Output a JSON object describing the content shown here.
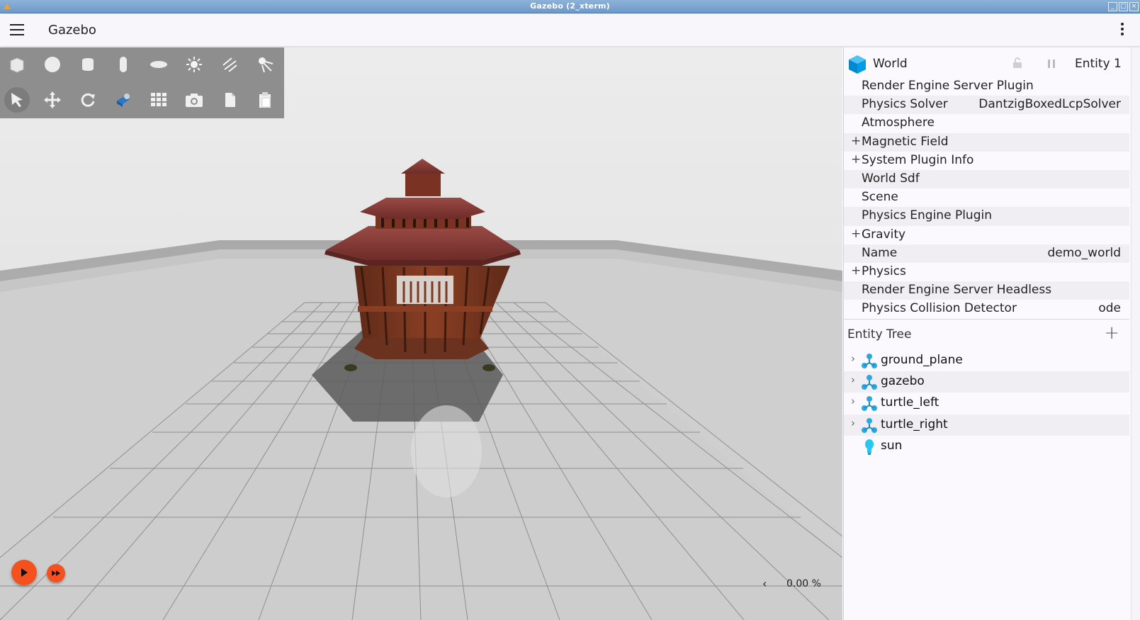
{
  "window": {
    "title": "Gazebo (2_xterm)"
  },
  "appbar": {
    "title": "Gazebo"
  },
  "toolbar": {
    "row1": [
      "box-icon",
      "sphere-icon",
      "cylinder-icon",
      "capsule-icon",
      "ellipsoid-icon",
      "sun-light-icon",
      "directional-light-icon",
      "spot-light-icon"
    ],
    "row2": [
      "select-icon",
      "translate-icon",
      "rotate-icon",
      "transform-icon",
      "grid-icon",
      "camera-icon",
      "copy-icon",
      "paste-icon"
    ]
  },
  "playback": {
    "rtf": "0.00 %"
  },
  "component_inspector": {
    "title": "World",
    "entity": "Entity 1",
    "rows": [
      {
        "label": "Render Engine Server Plugin",
        "value": "",
        "expandable": false
      },
      {
        "label": "Physics Solver",
        "value": "DantzigBoxedLcpSolver",
        "expandable": false
      },
      {
        "label": "Atmosphere",
        "value": "",
        "expandable": false
      },
      {
        "label": "Magnetic Field",
        "value": "",
        "expandable": true
      },
      {
        "label": "System Plugin Info",
        "value": "",
        "expandable": true
      },
      {
        "label": "World Sdf",
        "value": "",
        "expandable": false
      },
      {
        "label": "Scene",
        "value": "",
        "expandable": false
      },
      {
        "label": "Physics Engine Plugin",
        "value": "",
        "expandable": false
      },
      {
        "label": "Gravity",
        "value": "",
        "expandable": true
      },
      {
        "label": "Name",
        "value": "demo_world",
        "expandable": false
      },
      {
        "label": "Physics",
        "value": "",
        "expandable": true
      },
      {
        "label": "Render Engine Server Headless",
        "value": "",
        "expandable": false
      },
      {
        "label": "Physics Collision Detector",
        "value": "ode",
        "expandable": false
      }
    ]
  },
  "entity_tree": {
    "title": "Entity Tree",
    "items": [
      {
        "label": "ground_plane",
        "type": "model",
        "expandable": true
      },
      {
        "label": "gazebo",
        "type": "model",
        "expandable": true
      },
      {
        "label": "turtle_left",
        "type": "model",
        "expandable": true
      },
      {
        "label": "turtle_right",
        "type": "model",
        "expandable": true
      },
      {
        "label": "sun",
        "type": "light",
        "expandable": false
      }
    ]
  }
}
